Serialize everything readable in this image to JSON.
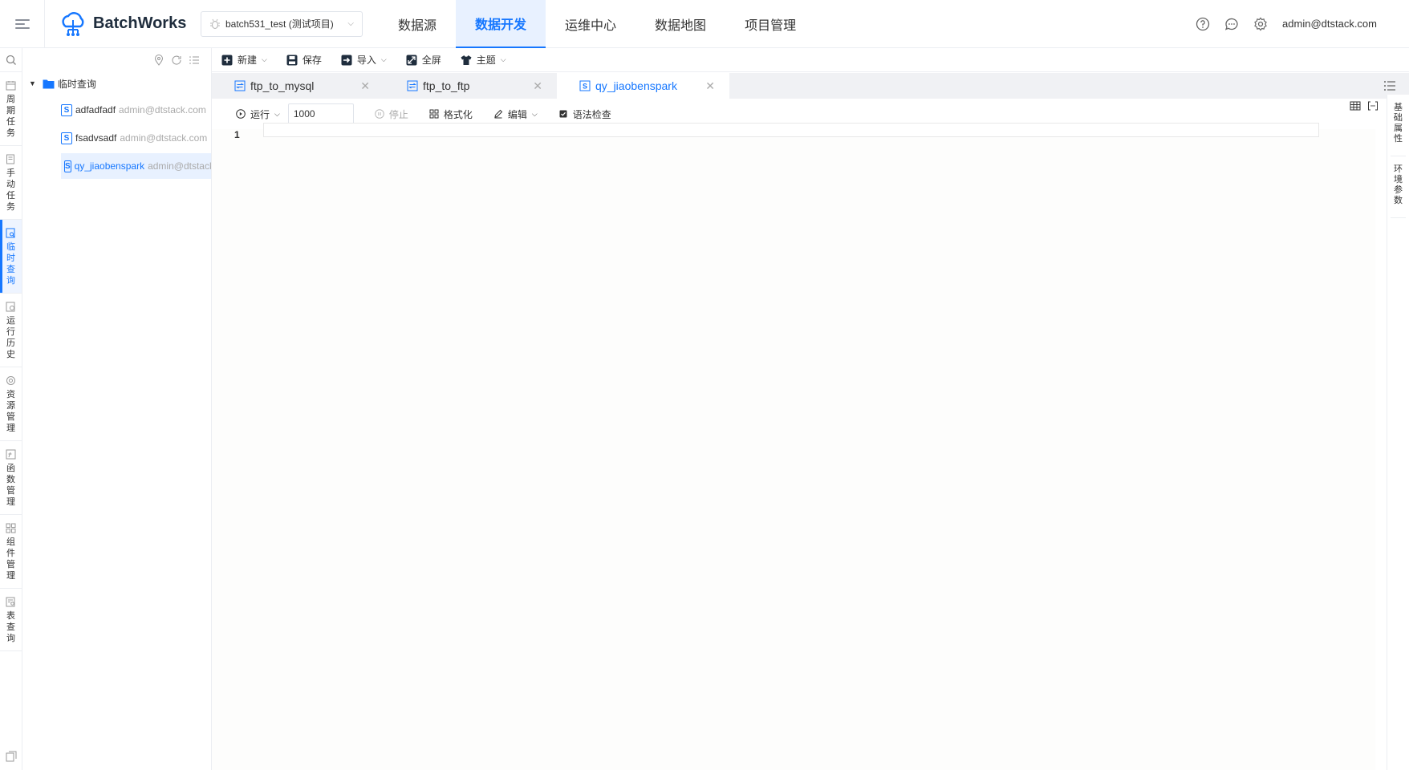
{
  "header": {
    "app_name": "BatchWorks",
    "project": "batch531_test (测试项目)",
    "nav": [
      "数据源",
      "数据开发",
      "运维中心",
      "数据地图",
      "项目管理"
    ],
    "nav_active": "数据开发",
    "user": "admin@dtstack.com"
  },
  "left_sidebar": {
    "items": [
      {
        "label": "周期任务",
        "icon": "calendar-icon"
      },
      {
        "label": "手动任务",
        "icon": "manual-task-icon"
      },
      {
        "label": "临时查询",
        "icon": "query-icon"
      },
      {
        "label": "运行历史",
        "icon": "history-icon"
      },
      {
        "label": "资源管理",
        "icon": "resource-icon"
      },
      {
        "label": "函数管理",
        "icon": "function-icon"
      },
      {
        "label": "组件管理",
        "icon": "component-icon"
      },
      {
        "label": "表查询",
        "icon": "table-query-icon"
      }
    ],
    "active": "临时查询"
  },
  "tree": {
    "folder": "临时查询",
    "files": [
      {
        "name": "adfadfadf",
        "owner": "admin@dtstack.com"
      },
      {
        "name": "fsadvsadf",
        "owner": "admin@dtstack.com"
      },
      {
        "name": "qy_jiaobenspark",
        "owner": "admin@dtstack.com"
      }
    ],
    "active_file": "qy_jiaobenspark"
  },
  "toolbar": {
    "new": "新建",
    "save": "保存",
    "import": "导入",
    "fullscreen": "全屏",
    "theme": "主题"
  },
  "tabs": [
    {
      "label": "ftp_to_mysql",
      "icon": "sync-task-icon"
    },
    {
      "label": "ftp_to_ftp",
      "icon": "sync-task-icon"
    },
    {
      "label": "qy_jiaobenspark",
      "icon": "script-s-icon"
    }
  ],
  "active_tab": "qy_jiaobenspark",
  "editor_toolbar": {
    "run": "运行",
    "limit_value": "1000",
    "stop": "停止",
    "format": "格式化",
    "edit": "编辑",
    "syntax_check": "语法检查"
  },
  "editor": {
    "line_numbers": [
      "1"
    ]
  },
  "right_rail": {
    "items": [
      "基础属性",
      "环境参数"
    ]
  },
  "colors": {
    "accent": "#1677ff",
    "active_bg": "#e8f1ff"
  }
}
